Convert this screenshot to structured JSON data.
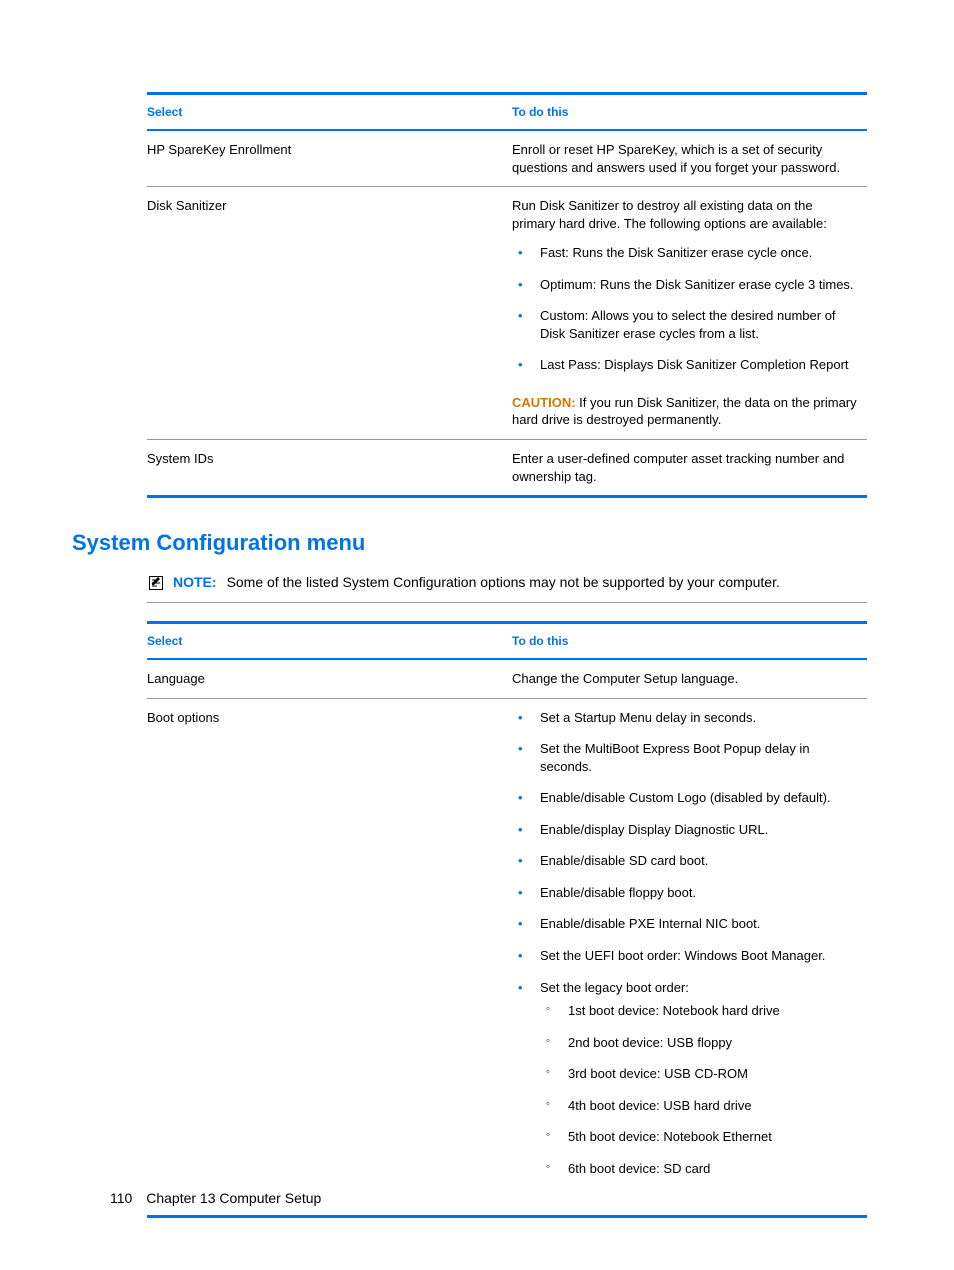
{
  "table1": {
    "header_select": "Select",
    "header_todo": "To do this",
    "rows": [
      {
        "select": "HP SpareKey Enrollment",
        "desc": "Enroll or reset HP SpareKey, which is a set of security questions and answers used if you forget your password."
      },
      {
        "select": "Disk Sanitizer",
        "desc": "Run Disk Sanitizer to destroy all existing data on the primary hard drive. The following options are available:",
        "bullets": [
          "Fast: Runs the Disk Sanitizer erase cycle once.",
          "Optimum: Runs the Disk Sanitizer erase cycle 3 times.",
          "Custom: Allows you to select the desired number of Disk Sanitizer erase cycles from a list.",
          "Last Pass: Displays Disk Sanitizer Completion Report"
        ],
        "caution_label": "CAUTION:",
        "caution_text": "If you run Disk Sanitizer, the data on the primary hard drive is destroyed permanently."
      },
      {
        "select": "System IDs",
        "desc": "Enter a user-defined computer asset tracking number and ownership tag."
      }
    ]
  },
  "section_heading": "System Configuration menu",
  "note": {
    "label": "NOTE:",
    "text": "Some of the listed System Configuration options may not be supported by your computer."
  },
  "table2": {
    "header_select": "Select",
    "header_todo": "To do this",
    "rows": [
      {
        "select": "Language",
        "desc": "Change the Computer Setup language."
      },
      {
        "select": "Boot options",
        "bullets": [
          "Set a Startup Menu delay in seconds.",
          "Set the MultiBoot Express Boot Popup delay in seconds.",
          "Enable/disable Custom Logo (disabled by default).",
          "Enable/display Display Diagnostic URL.",
          "Enable/disable SD card boot.",
          "Enable/disable floppy boot.",
          "Enable/disable PXE Internal NIC boot.",
          "Set the UEFI boot order: Windows Boot Manager.",
          "Set the legacy boot order:"
        ],
        "sub_bullets": [
          "1st boot device: Notebook hard drive",
          "2nd boot device: USB floppy",
          "3rd boot device: USB CD-ROM",
          "4th boot device: USB hard drive",
          "5th boot device: Notebook Ethernet",
          "6th boot device: SD card"
        ]
      }
    ]
  },
  "footer": {
    "page_number": "110",
    "chapter": "Chapter 13   Computer Setup"
  }
}
